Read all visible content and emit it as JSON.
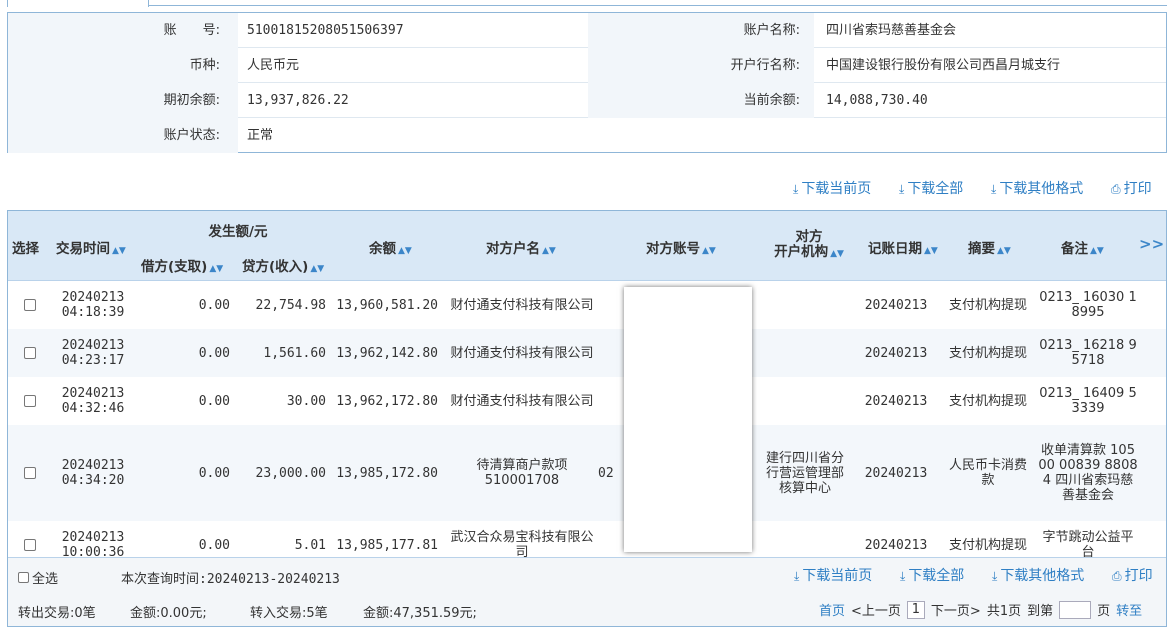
{
  "account": {
    "account_no_label": "账　　号:",
    "account_no": "51001815208051506397",
    "account_name_label": "账户名称:",
    "account_name": "四川省索玛慈善基金会",
    "currency_label": "币种:",
    "currency": "人民币元",
    "bank_label": "开户行名称:",
    "bank": "中国建设银行股份有限公司西昌月城支行",
    "opening_balance_label": "期初余额:",
    "opening_balance": "13,937,826.22",
    "current_balance_label": "当前余额:",
    "current_balance": "14,088,730.40",
    "status_label": "账户状态:",
    "status": "正常"
  },
  "actions": {
    "download_current": "下载当前页",
    "download_all": "下载全部",
    "download_other": "下载其他格式",
    "print": "打印"
  },
  "table": {
    "headers": {
      "select": "选择",
      "time": "交易时间",
      "amount_group": "发生额/元",
      "debit": "借方(支取)",
      "credit": "贷方(收入)",
      "balance": "余额",
      "counterparty": "对方户名",
      "counter_account": "对方账号",
      "counter_bank_l1": "对方",
      "counter_bank_l2": "开户机构",
      "post_date": "记账日期",
      "summary": "摘要",
      "remark": "备注",
      "more": ">>"
    },
    "rows": [
      {
        "date": "20240213",
        "time": "04:18:39",
        "debit": "0.00",
        "credit": "22,754.98",
        "balance": "13,960,581.20",
        "counterparty": "财付通支付科技有限公司",
        "account": "",
        "bank": "",
        "post_date": "20240213",
        "summary": "支付机构提现",
        "remark": "0213_ 16030 18995"
      },
      {
        "date": "20240213",
        "time": "04:23:17",
        "debit": "0.00",
        "credit": "1,561.60",
        "balance": "13,962,142.80",
        "counterparty": "财付通支付科技有限公司",
        "account": "",
        "bank": "",
        "post_date": "20240213",
        "summary": "支付机构提现",
        "remark": "0213_ 16218 95718"
      },
      {
        "date": "20240213",
        "time": "04:32:46",
        "debit": "0.00",
        "credit": "30.00",
        "balance": "13,962,172.80",
        "counterparty": "财付通支付科技有限公司",
        "account": "",
        "bank": "",
        "post_date": "20240213",
        "summary": "支付机构提现",
        "remark": "0213_ 16409 53339"
      },
      {
        "date": "20240213",
        "time": "04:34:20",
        "debit": "0.00",
        "credit": "23,000.00",
        "balance": "13,985,172.80",
        "counterparty": "待清算商户款项510001708",
        "account": "02",
        "bank": "建行四川省分行营运管理部核算中心",
        "post_date": "20240213",
        "summary": "人民币卡消费款",
        "remark": "收单清算款 10500 00839 88084 四川省索玛慈善基金会"
      },
      {
        "date": "20240213",
        "time": "10:00:36",
        "debit": "0.00",
        "credit": "5.01",
        "balance": "13,985,177.81",
        "counterparty": "武汉合众易宝科技有限公司",
        "account": "",
        "bank": "",
        "post_date": "20240213",
        "summary": "支付机构提现",
        "remark": "字节跳动公益平台"
      }
    ]
  },
  "footer": {
    "select_all": "全选",
    "query_time": "本次查询时间:20240213-20240213",
    "out_summary": "转出交易:0笔",
    "out_amount": "金额:0.00元;",
    "in_summary": "转入交易:5笔",
    "in_amount": "金额:47,351.59元;",
    "first": "首页",
    "prev": "<上一页",
    "page": "1",
    "next": "下一页>",
    "total": "共1页",
    "goto": "到第",
    "page_unit": "页",
    "go": "转至"
  },
  "colors": {
    "accent": "#2f7fc4",
    "header_bg": "#d9e8f6",
    "border": "#8fb6d8"
  }
}
